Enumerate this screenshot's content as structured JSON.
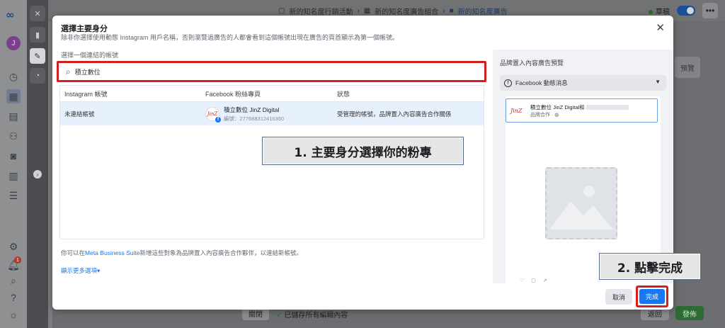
{
  "app": {
    "avatar_letter": "J",
    "breadcrumb": [
      "新的知名度行銷活動",
      "新的知名度廣告組合",
      "新的知名度廣告"
    ],
    "status_label": "草稿",
    "right_panel_btn": "預覽",
    "close_btn": "關閉",
    "saved_msg": "已儲存所有編輯內容",
    "back_btn": "返回",
    "publish_btn": "發佈",
    "notification_count": "1"
  },
  "modal": {
    "title": "選擇主要身分",
    "subtitle": "除非你選擇使用動態 Instagram 用戶名稱，否則瀏覽過廣告的人都會看到這個帳號出現在廣告的頁首顯示為第一個帳號。",
    "account_label": "選擇一個連結的帳號",
    "search_value": "積立數位",
    "table": {
      "headers": [
        "Instagram 帳號",
        "Facebook 粉絲專頁",
        "狀態"
      ],
      "rows": [
        {
          "instagram": "未連結帳號",
          "page_logo": "JinZ",
          "page_name": "積立數位 JinZ Digital",
          "page_id": "編號：277688312416360",
          "status": "受管理的帳號，品牌置入內容廣告合作關係"
        }
      ]
    },
    "footnote_prefix": "你可以在",
    "footnote_link": "Meta Business Suite",
    "footnote_suffix": "新增這些對象為品牌置入內容廣告合作夥伴，以連結新帳號。",
    "show_more": "顯示更多選項▾",
    "preview": {
      "title": "品牌置入內容廣告預覽",
      "placement": "Facebook 動態消息",
      "ad_logo": "JinZ",
      "ad_name": "積立數位 JinZ Digital和",
      "ad_meta": "品牌合作 · "
    },
    "cancel_btn": "取消",
    "done_btn": "完成"
  },
  "annotations": {
    "step1": "1. 主要身分選擇你的粉專",
    "step2": "2. 點擊完成"
  },
  "colors": {
    "highlight_red": "#d1211f",
    "primary_blue": "#1877f2",
    "publish_green": "#2c6b33"
  }
}
